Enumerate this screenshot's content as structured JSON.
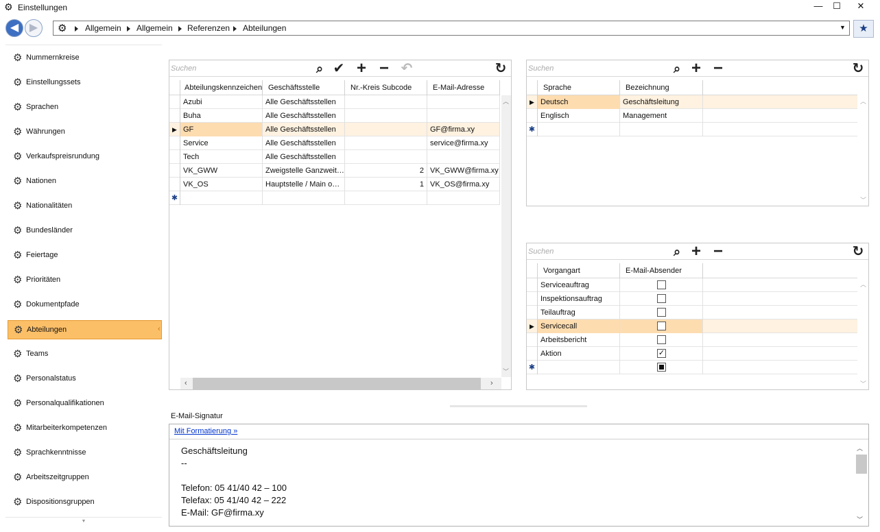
{
  "window": {
    "title": "Einstellungen",
    "minimize": "—",
    "maximize": "☐",
    "close": "✕"
  },
  "nav": {
    "back": "◀",
    "forward": "▶",
    "crumbs": [
      "Allgemein",
      "Allgemein",
      "Referenzen",
      "Abteilungen"
    ],
    "dropdown": "▼",
    "favorite": "★"
  },
  "sidebar": {
    "items": [
      "Nummernkreise",
      "Einstellungssets",
      "Sprachen",
      "Währungen",
      "Verkaufspreisrundung",
      "Nationen",
      "Nationalitäten",
      "Bundesländer",
      "Feiertage",
      "Prioritäten",
      "Dokumentpfade",
      "Abteilungen",
      "Teams",
      "Personalstatus",
      "Personalqualifikationen",
      "Mitarbeiterkompetenzen",
      "Sprachkenntnisse",
      "Arbeitszeitgruppen",
      "Dispositionsgruppen"
    ],
    "selected": "Abteilungen",
    "gear": "⚙",
    "scroll_down": "▼"
  },
  "main_grid": {
    "search_placeholder": "Suchen",
    "columns": [
      "Abteilungskennzeichen",
      "Geschäftsstelle",
      "Nr.-Kreis Subcode",
      "E-Mail-Adresse"
    ],
    "rows": [
      [
        "Azubi",
        "Alle Geschäftsstellen",
        "",
        ""
      ],
      [
        "Buha",
        "Alle Geschäftsstellen",
        "",
        ""
      ],
      [
        "GF",
        "Alle Geschäftsstellen",
        "",
        "GF@firma.xy"
      ],
      [
        "Service",
        "Alle Geschäftsstellen",
        "",
        "service@firma.xy"
      ],
      [
        "Tech",
        "Alle Geschäftsstellen",
        "",
        ""
      ],
      [
        "VK_GWW",
        "Zweigstelle Ganzweit…",
        "2",
        "VK_GWW@firma.xy"
      ],
      [
        "VK_OS",
        "Hauptstelle / Main o…",
        "1",
        "VK_OS@firma.xy"
      ]
    ],
    "selected_row": 2
  },
  "lang_grid": {
    "search_placeholder": "Suchen",
    "columns": [
      "Sprache",
      "Bezeichnung"
    ],
    "rows": [
      [
        "Deutsch",
        "Geschäftsleitung"
      ],
      [
        "Englisch",
        "Management"
      ]
    ],
    "selected_row": 0
  },
  "proc_grid": {
    "search_placeholder": "Suchen",
    "columns": [
      "Vorgangart",
      "E-Mail-Absender"
    ],
    "rows": [
      {
        "name": "Serviceauftrag",
        "checked": false
      },
      {
        "name": "Inspektionsauftrag",
        "checked": false
      },
      {
        "name": "Teilauftrag",
        "checked": false
      },
      {
        "name": "Servicecall",
        "checked": false
      },
      {
        "name": "Arbeitsbericht",
        "checked": false
      },
      {
        "name": "Aktion",
        "checked": true
      }
    ],
    "selected_row": 3
  },
  "toolbar_icons": {
    "search": "⌕",
    "confirm": "✔",
    "add": "+",
    "remove": "−",
    "undo": "↶",
    "refresh": "↻"
  },
  "signature": {
    "label": "E-Mail-Signatur",
    "format_link": "Mit Formatierung »",
    "lines": [
      "Geschäftsleitung",
      "--",
      "",
      "Telefon: 05 41/40 42 – 100",
      "Telefax: 05 41/40 42 – 222",
      "E-Mail: GF@firma.xy"
    ]
  },
  "colors": {
    "selection": "#fbbf68",
    "row_highlight": "#fff2e0",
    "accent": "#1b3f86"
  }
}
